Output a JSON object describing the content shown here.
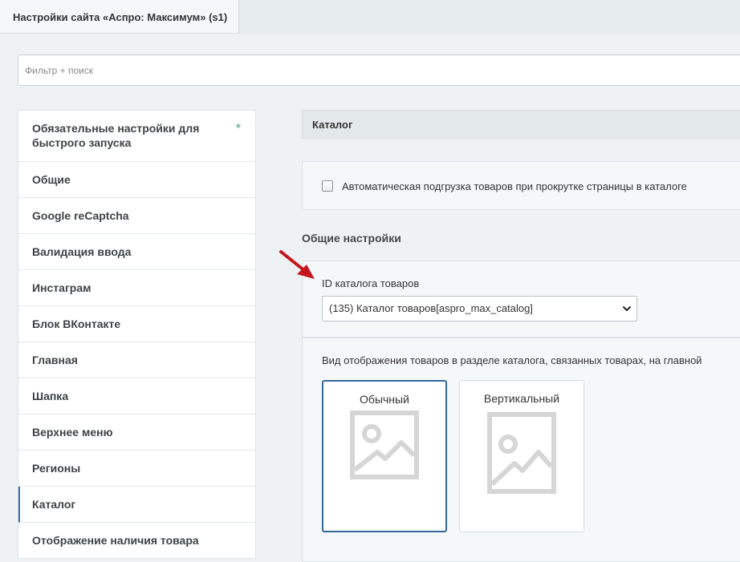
{
  "tab": {
    "title": "Настройки сайта «Аспро: Максимум» (s1)"
  },
  "filter": {
    "placeholder": "Фильтр + поиск"
  },
  "sidebar": {
    "items": [
      {
        "label": "Обязательные настройки для быстрого запуска",
        "marker": "*"
      },
      {
        "label": "Общие"
      },
      {
        "label": "Google reCaptcha"
      },
      {
        "label": "Валидация ввода"
      },
      {
        "label": "Инстаграм"
      },
      {
        "label": "Блок ВКонтакте"
      },
      {
        "label": "Главная"
      },
      {
        "label": "Шапка"
      },
      {
        "label": "Верхнее меню"
      },
      {
        "label": "Регионы"
      },
      {
        "label": "Каталог",
        "active": true
      },
      {
        "label": "Отображение наличия товара"
      }
    ]
  },
  "main": {
    "section_title": "Каталог",
    "autoload": {
      "label": "Автоматическая подгрузка товаров при прокрутке страницы в каталоге",
      "checked": false
    },
    "general_title": "Общие настройки",
    "catalog_id": {
      "label": "ID каталога товаров",
      "selected": "(135) Каталог товаров[aspro_max_catalog]"
    },
    "view": {
      "label": "Вид отображения товаров в разделе каталога, связанных товарах, на главной",
      "options": [
        {
          "label": "Обычный",
          "selected": true
        },
        {
          "label": "Вертикальный",
          "selected": false
        }
      ]
    }
  },
  "colors": {
    "accent": "#35679b",
    "arrow": "#c4161c",
    "placeholder_icon": "#d6d6d6"
  },
  "icons": {
    "select": "chevron-down-icon",
    "card": "image-placeholder-icon",
    "annotation": "red-arrow-icon"
  }
}
